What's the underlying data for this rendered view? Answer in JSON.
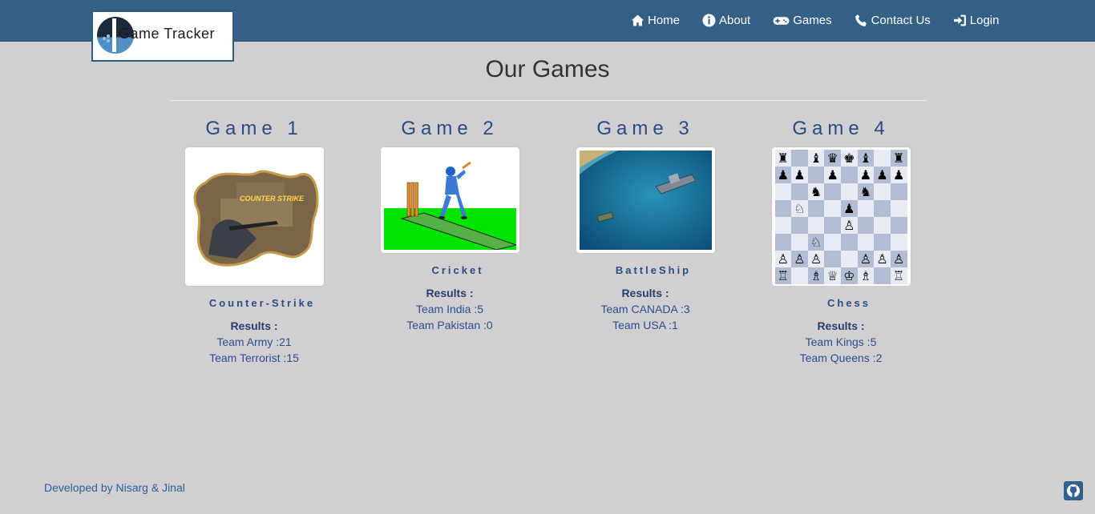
{
  "brand": {
    "name": "Game Tracker"
  },
  "nav": {
    "items": [
      {
        "label": "Home",
        "icon": "home-icon"
      },
      {
        "label": "About",
        "icon": "info-icon"
      },
      {
        "label": "Games",
        "icon": "gamepad-icon"
      },
      {
        "label": "Contact Us",
        "icon": "phone-icon"
      },
      {
        "label": "Login",
        "icon": "login-icon"
      }
    ]
  },
  "page": {
    "title": "Our Games"
  },
  "games": [
    {
      "heading": "Game 1",
      "name": "Counter-Strike",
      "results_label": "Results :",
      "results": [
        "Team Army :21",
        "Team Terrorist :15"
      ],
      "image_text": "COUNTER STRIKE"
    },
    {
      "heading": "Game 2",
      "name": "Cricket",
      "results_label": "Results :",
      "results": [
        "Team India :5",
        "Team Pakistan :0"
      ]
    },
    {
      "heading": "Game 3",
      "name": "BattleShip",
      "results_label": "Results :",
      "results": [
        "Team CANADA :3",
        "Team USA :1"
      ]
    },
    {
      "heading": "Game 4",
      "name": "Chess",
      "results_label": "Results :",
      "results": [
        "Team Kings :5",
        "Team Queens :2"
      ]
    }
  ],
  "footer": {
    "credit": "Developed by Nisarg & Jinal",
    "icon": "github-icon"
  },
  "colors": {
    "navbar": "#346086",
    "background": "#d1cfd1",
    "heading": "#2a4d80",
    "link": "#2c5d9e"
  }
}
